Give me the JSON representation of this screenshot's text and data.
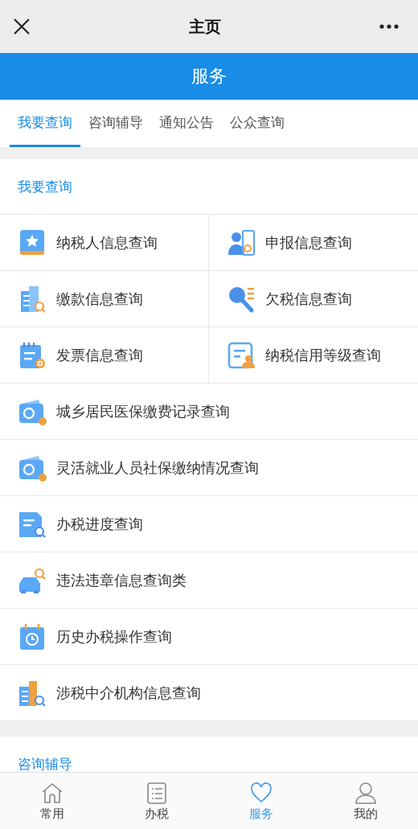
{
  "header": {
    "title": "主页"
  },
  "banner": {
    "title": "服务"
  },
  "tabs": [
    {
      "label": "我要查询",
      "selected": true
    },
    {
      "label": "咨询辅导",
      "selected": false
    },
    {
      "label": "通知公告",
      "selected": false
    },
    {
      "label": "公众查询",
      "selected": false
    }
  ],
  "section": {
    "title": "我要查询"
  },
  "grid_items": [
    {
      "label": "纳税人信息查询"
    },
    {
      "label": "申报信息查询"
    },
    {
      "label": "缴款信息查询"
    },
    {
      "label": "欠税信息查询"
    },
    {
      "label": "发票信息查询"
    },
    {
      "label": "纳税信用等级查询"
    }
  ],
  "list_items": [
    {
      "label": "城乡居民医保缴费记录查询"
    },
    {
      "label": "灵活就业人员社保缴纳情况查询"
    },
    {
      "label": "办税进度查询"
    },
    {
      "label": "违法违章信息查询类"
    },
    {
      "label": "历史办税操作查询"
    },
    {
      "label": "涉税中介机构信息查询"
    }
  ],
  "next_section": {
    "title": "咨询辅导"
  },
  "bottom_nav": [
    {
      "label": "常用",
      "selected": false
    },
    {
      "label": "办税",
      "selected": false
    },
    {
      "label": "服务",
      "selected": true
    },
    {
      "label": "我的",
      "selected": false
    }
  ]
}
